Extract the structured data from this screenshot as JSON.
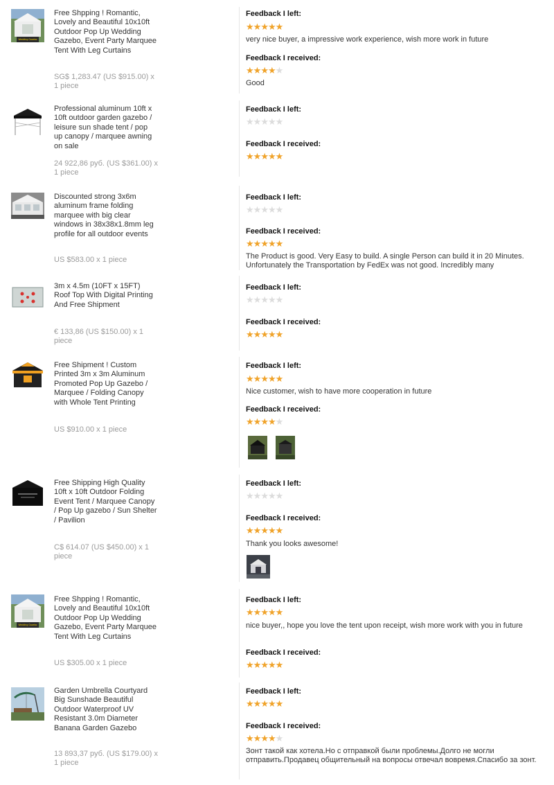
{
  "labels": {
    "left": "Feedback I left:",
    "received": "Feedback I received:"
  },
  "colors": {
    "star_on": "#f0a32a",
    "star_off": "#dcdcdc",
    "price": "#9a9a9a"
  },
  "orders": [
    {
      "title": "Free Shpping ! Romantic, Lovely and Beautiful 10x10ft Outdoor Pop Up Wedding Gazebo, Event Party Marquee Tent With Leg Curtains",
      "price": "SG$ 1,283.47 (US $915.00) x 1 piece",
      "thumb_icon": "white-wedding-tent-icon",
      "left_stars": 5,
      "left_comment": "very nice buyer, a impressive work experience, wish more work in future",
      "received_stars": 4,
      "received_comment": "Good"
    },
    {
      "title": "Professional aluminum 10ft x 10ft outdoor garden gazebo / leisure sun shade tent / pop up canopy / marquee awning on sale",
      "price": "24 922,86 руб. (US $361.00) x 1 piece",
      "thumb_icon": "black-canopy-frame-icon",
      "left_stars": 0,
      "left_comment": "",
      "received_stars": 5,
      "received_comment": ""
    },
    {
      "title": "Discounted strong 3x6m aluminum frame folding marquee with big clear windows in 38x38x1.8mm leg profile for all outdoor events",
      "price": "US $583.00 x 1 piece",
      "thumb_icon": "white-marquee-icon",
      "left_stars": 0,
      "left_comment": "",
      "received_stars": 5,
      "received_comment": "The Product is good. Very Easy to build. A single Person can build it in 20 Minutes. Unfortunately the Transportation by FedEx was not good. Incredibly many"
    },
    {
      "title": "3m x 4.5m (10FT x 15FT) Roof Top With Digital Printing And Free Shipment",
      "price": "€ 133,86 (US $150.00) x 1 piece",
      "thumb_icon": "printed-roof-top-icon",
      "left_stars": 0,
      "left_comment": "",
      "received_stars": 5,
      "received_comment": ""
    },
    {
      "title": "Free Shipment ! Custom Printed 3m x 3m Aluminum Promoted Pop Up Gazebo / Marquee / Folding Canopy with Whole Tent Printing",
      "price": "US $910.00 x 1 piece",
      "thumb_icon": "orange-black-gazebo-icon",
      "left_stars": 5,
      "left_comment": "Nice customer, wish to have more cooperation in future",
      "received_stars": 4,
      "received_comment": ""
    },
    {
      "title": "Free Shipping High Quality 10ft x 10ft Outdoor Folding Event Tent / Marquee Canopy / Pop Up gazebo / Sun Shelter / Pavilion",
      "price": "C$ 614.07 (US $450.00) x 1 piece",
      "thumb_icon": "black-event-tent-icon",
      "left_stars": 0,
      "left_comment": "",
      "received_stars": 5,
      "received_comment": "Thank you looks awesome!"
    },
    {
      "title": "Free Shpping ! Romantic, Lovely and Beautiful 10x10ft Outdoor Pop Up Wedding Gazebo, Event Party Marquee Tent With Leg Curtains",
      "price": "US $305.00 x 1 piece",
      "thumb_icon": "white-wedding-tent-icon",
      "left_stars": 5,
      "left_comment": "nice buyer,, hope you love the tent upon receipt, wish more work with you in future",
      "received_stars": 5,
      "received_comment": ""
    },
    {
      "title": "Garden Umbrella Courtyard Big Sunshade Beautiful Outdoor Waterproof UV Resistant 3.0m Diameter Banana Garden Gazebo",
      "price": "13 893,37 руб. (US $179.00) x 1 piece",
      "thumb_icon": "banana-umbrella-icon",
      "left_stars": 5,
      "left_comment": "",
      "received_stars": 4,
      "received_comment": "Зонт такой как хотела.Но с отправкой были проблемы.Долго не могли отправить.Продавец общительный на вопросы отвечал вовремя.Спасибо за зонт."
    }
  ]
}
